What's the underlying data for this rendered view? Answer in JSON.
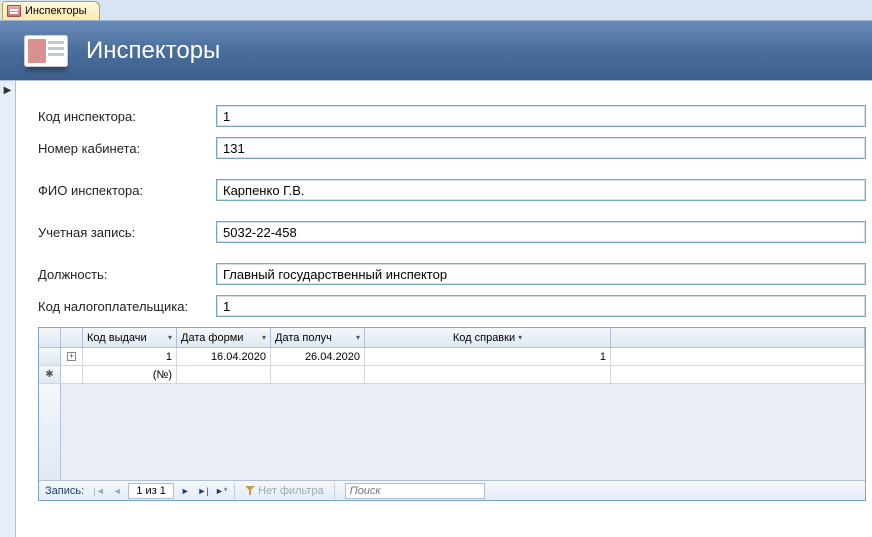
{
  "tab": {
    "label": "Инспекторы"
  },
  "header": {
    "title": "Инспекторы"
  },
  "fields": {
    "code_label": "Код инспектора:",
    "code_value": "1",
    "room_label": "Номер кабинета:",
    "room_value": "131",
    "fio_label": "ФИО инспектора:",
    "fio_value": "Карпенко Г.В.",
    "account_label": "Учетная запись:",
    "account_value": "5032-22-458",
    "position_label": "Должность:",
    "position_value": "Главный государственный инспектор",
    "taxpayer_label": "Код налогоплательщика:",
    "taxpayer_value": "1"
  },
  "subgrid": {
    "columns": {
      "issue_code": "Код выдачи",
      "form_date": "Дата форми",
      "receive_date": "Дата получ",
      "ref_code": "Код справки"
    },
    "rows": [
      {
        "issue_code": "1",
        "form_date": "16.04.2020",
        "receive_date": "26.04.2020",
        "ref_code": "1"
      }
    ],
    "new_row_placeholder": "(№)"
  },
  "nav": {
    "label": "Запись:",
    "position": "1 из 1",
    "no_filter": "Нет фильтра",
    "search_placeholder": "Поиск"
  },
  "icons": {
    "first": "|◄",
    "prev": "◄",
    "next": "►",
    "last": "►|",
    "new": "►*",
    "expand": "+",
    "newrow": "✱",
    "marker": "▶"
  }
}
